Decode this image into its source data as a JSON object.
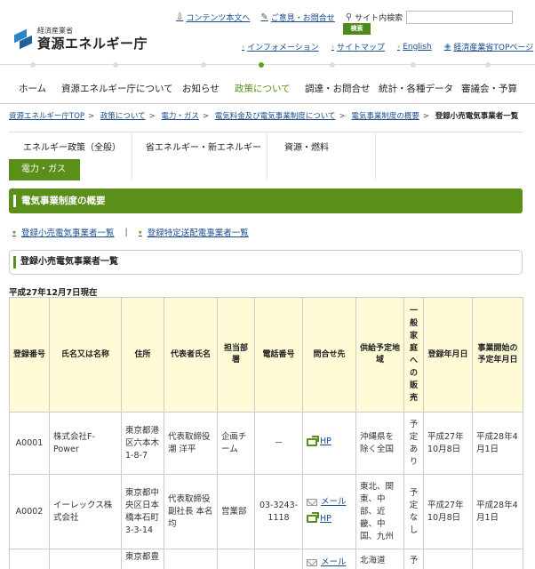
{
  "header": {
    "ministry": "経済産業省",
    "agency": "資源エネルギー庁",
    "utility_links": [
      "コンテンツ本文へ",
      "ご意見・お問合せ"
    ],
    "search_label": "サイト内検索",
    "search_value": "",
    "search_button": "検索",
    "sub_links": [
      "インフォメーション",
      "サイトマップ",
      "English",
      "経済産業省TOPページ"
    ]
  },
  "global_nav": [
    "ホーム",
    "資源エネルギー庁について",
    "お知らせ",
    "政策について",
    "調達・お問合せ",
    "統計・各種データ",
    "審議会・予算"
  ],
  "breadcrumb": [
    "資源エネルギー庁TOP",
    "政策について",
    "電力・ガス",
    "電気料金及び電気事業制度について",
    "電気事業制度の概要",
    "登録小売電気事業者一覧"
  ],
  "local_tabs": [
    "エネルギー政策（全般）",
    "省エネルギー・新エネルギー",
    "資源・燃料",
    "電力・ガス"
  ],
  "section_title": "電気事業制度の概要",
  "anchor_links": [
    "登録小売電気事業者一覧",
    "登録特定送配電事業者一覧"
  ],
  "subsection_title": "登録小売電気事業者一覧",
  "as_of": "平成27年12月7日現在",
  "table": {
    "headers": [
      "登録番号",
      "氏名又は名称",
      "住所",
      "代表者氏名",
      "担当部署",
      "電話番号",
      "問合せ先",
      "供給予定地域",
      "一般家庭への販売",
      "登録年月日",
      "事業開始の予定年月日"
    ],
    "rows": [
      {
        "no": "A0001",
        "name": "株式会社F-Power",
        "address": "東京都港区六本木1-8-7",
        "rep": "代表取締役 潮 洋平",
        "dept": "企画チーム",
        "tel": "－",
        "contact_hp": "HP",
        "contact_mail": "",
        "area": "沖縄県を除く全国",
        "household": "予定あり",
        "reg_date": "平成27年10月8日",
        "start_date": "平成28年4月1日"
      },
      {
        "no": "A0002",
        "name": "イーレックス株式会社",
        "address": "東京都中央区日本橋本石町3-3-14",
        "rep": "代表取締役副社長 本名 均",
        "dept": "営業部",
        "tel": "03-3243-1118",
        "contact_hp": "HP",
        "contact_mail": "メール",
        "area": "東北、関東、中部、近畿、中国、九州",
        "household": "予定なし",
        "reg_date": "平成27年10月8日",
        "start_date": "平成28年4月1日"
      },
      {
        "no": "",
        "name": "",
        "address": "東京都豊",
        "rep": "",
        "dept": "",
        "tel": "",
        "contact_hp": "",
        "contact_mail": "メール",
        "area": "北海道",
        "household": "予",
        "reg_date": "",
        "start_date": ""
      }
    ]
  }
}
